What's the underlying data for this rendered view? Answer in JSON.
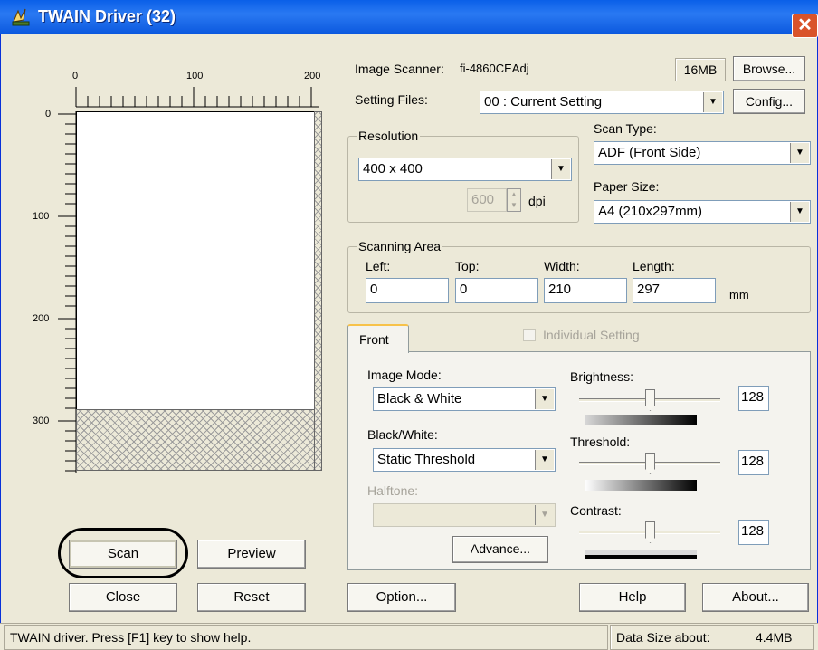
{
  "window": {
    "title": "TWAIN Driver (32)"
  },
  "preview": {
    "hruler_labels": [
      "0",
      "100",
      "200"
    ],
    "vruler_labels": [
      "0",
      "100",
      "200",
      "300"
    ]
  },
  "scanner": {
    "label": "Image Scanner:",
    "model": "fi-4860CEAdj",
    "memory": "16MB",
    "browse_label": "Browse..."
  },
  "setting_files": {
    "label": "Setting Files:",
    "value": "00 : Current Setting",
    "config_label": "Config..."
  },
  "resolution": {
    "group_label": "Resolution",
    "value": "400 x 400",
    "custom_value": "600",
    "unit": "dpi"
  },
  "scan_type": {
    "label": "Scan Type:",
    "value": "ADF (Front Side)"
  },
  "paper_size": {
    "label": "Paper Size:",
    "value": "A4 (210x297mm)"
  },
  "scanning_area": {
    "group_label": "Scanning Area",
    "left_label": "Left:",
    "left_value": "0",
    "top_label": "Top:",
    "top_value": "0",
    "width_label": "Width:",
    "width_value": "210",
    "length_label": "Length:",
    "length_value": "297",
    "unit": "mm"
  },
  "tabs": {
    "front_label": "Front",
    "individual_label": "Individual Setting"
  },
  "image_mode": {
    "label": "Image Mode:",
    "value": "Black & White"
  },
  "black_white": {
    "label": "Black/White:",
    "value": "Static Threshold"
  },
  "halftone": {
    "label": "Halftone:",
    "value": ""
  },
  "advance_label": "Advance...",
  "brightness": {
    "label": "Brightness:",
    "value": "128",
    "level": 0.5
  },
  "threshold": {
    "label": "Threshold:",
    "value": "128",
    "level": 0.5
  },
  "contrast": {
    "label": "Contrast:",
    "value": "128",
    "level": 0.5
  },
  "buttons": {
    "scan": "Scan",
    "preview": "Preview",
    "close": "Close",
    "reset": "Reset",
    "option": "Option...",
    "help": "Help",
    "about": "About..."
  },
  "status": {
    "help_text": "TWAIN driver. Press [F1] key to show help.",
    "data_size_label": "Data Size about:",
    "data_size_value": "4.4MB"
  },
  "colors": {
    "title_bar": "#0a5fe8",
    "highlight_circle": "#000000",
    "window_bg": "#ece9d8"
  }
}
